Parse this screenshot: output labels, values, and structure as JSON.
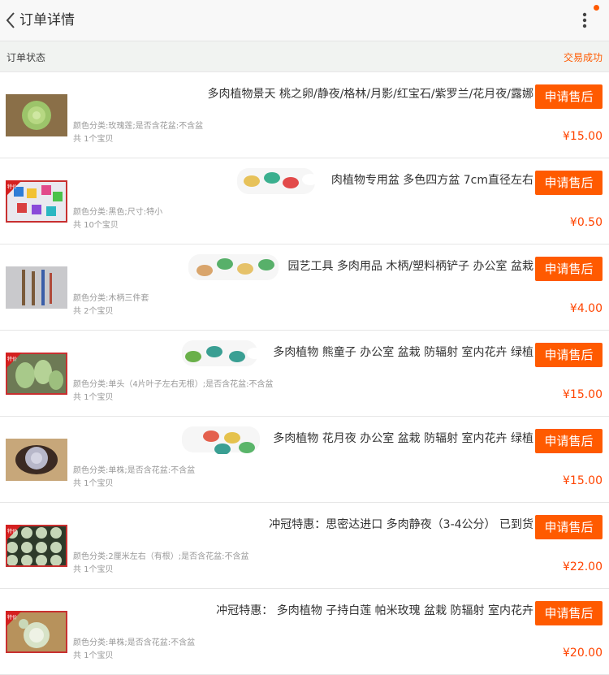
{
  "header": {
    "title": "订单详情",
    "back_icon": "chevron-left-icon",
    "more_icon": "more-vertical-icon"
  },
  "colors": {
    "accent": "#ff5a00",
    "price": "#ff4400",
    "badge": "#ff5a00"
  },
  "status": {
    "label": "订单状态",
    "value": "交易成功"
  },
  "items": [
    {
      "name": "多肉植物景天 桃之卵/静夜/格林/月影/红宝石/紫罗兰/花月夜/露娜",
      "spec": "颜色分类:玫瑰莲;是否含花盆:不含盆",
      "count": "共 1个宝贝",
      "price": "¥15.00",
      "button": "申请售后",
      "thumb": "succulent-rosette"
    },
    {
      "name": "肉植物专用盆 多色四方盆 7cm直径左右",
      "spec": "颜色分类:黑色;尺寸:特小",
      "count": "共 10个宝贝",
      "price": "¥0.50",
      "button": "申请售后",
      "thumb": "colored-pots",
      "badge": "特价"
    },
    {
      "name": "园艺工具 多肉用品 木柄/塑料柄铲子 办公室 盆栽",
      "spec": "颜色分类:木柄三件套",
      "count": "共 2个宝贝",
      "price": "¥4.00",
      "button": "申请售后",
      "thumb": "garden-tools"
    },
    {
      "name": "多肉植物 熊童子 办公室 盆栽 防辐射 室内花卉 绿植",
      "spec": "颜色分类:单头（4片叶子左右无根）;是否含花盆:不含盆",
      "count": "共 1个宝贝",
      "price": "¥15.00",
      "button": "申请售后",
      "thumb": "bear-paw",
      "badge": "特价"
    },
    {
      "name": "多肉植物 花月夜 办公室 盆栽 防辐射 室内花卉 绿植",
      "spec": "颜色分类:单株;是否含花盆:不含盆",
      "count": "共 1个宝贝",
      "price": "¥15.00",
      "button": "申请售后",
      "thumb": "purple-rosette"
    },
    {
      "name": "冲冠特惠：思密达进口 多肉静夜（3-4公分） 已到货",
      "spec": "颜色分类:2厘米左右（有根）;是否含花盆:不含盆",
      "count": "共 1个宝贝",
      "price": "¥22.00",
      "button": "申请售后",
      "thumb": "succulent-grid",
      "badge": "特价"
    },
    {
      "name": "冲冠特惠： 多肉植物 子持白莲 帕米玫瑰 盆栽 防辐射 室内花卉",
      "spec": "颜色分类:单株;是否含花盆:不含盆",
      "count": "共 1个宝贝",
      "price": "¥20.00",
      "button": "申请售后",
      "thumb": "white-lotus",
      "badge": "特价"
    }
  ]
}
